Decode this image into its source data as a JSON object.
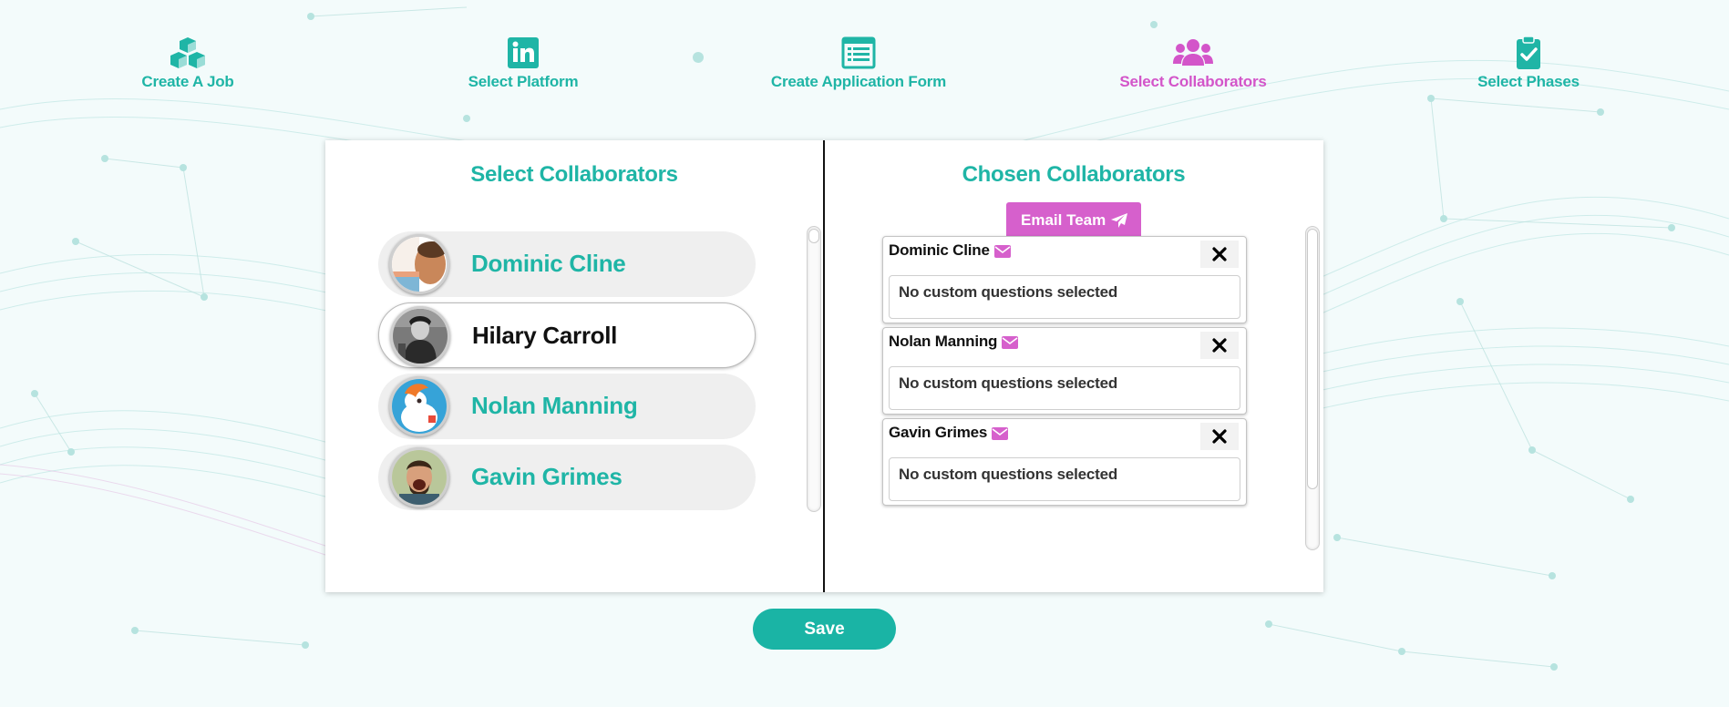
{
  "colors": {
    "accent": "#1fb5a6",
    "active_step": "#d355c9",
    "email_button": "#d660cc",
    "save_button": "#1ab4a5"
  },
  "steps": [
    {
      "label": "Create A Job",
      "icon": "cubes-icon"
    },
    {
      "label": "Select Platform",
      "icon": "linkedin-icon"
    },
    {
      "label": "Create Application Form",
      "icon": "form-icon"
    },
    {
      "label": "Select Collaborators",
      "icon": "users-icon",
      "active": true
    },
    {
      "label": "Select Phases",
      "icon": "clipboard-check-icon"
    }
  ],
  "left_panel": {
    "title": "Select Collaborators",
    "people": [
      {
        "name": "Dominic Cline",
        "selected": false
      },
      {
        "name": "Hilary Carroll",
        "selected": true
      },
      {
        "name": "Nolan Manning",
        "selected": false
      },
      {
        "name": "Gavin Grimes",
        "selected": false
      }
    ]
  },
  "right_panel": {
    "title": "Chosen Collaborators",
    "email_button": "Email Team",
    "collaborators": [
      {
        "name": "Dominic Cline",
        "questions": "No custom questions selected"
      },
      {
        "name": "Nolan Manning",
        "questions": "No custom questions selected"
      },
      {
        "name": "Gavin Grimes",
        "questions": "No custom questions selected"
      }
    ]
  },
  "save_label": "Save"
}
